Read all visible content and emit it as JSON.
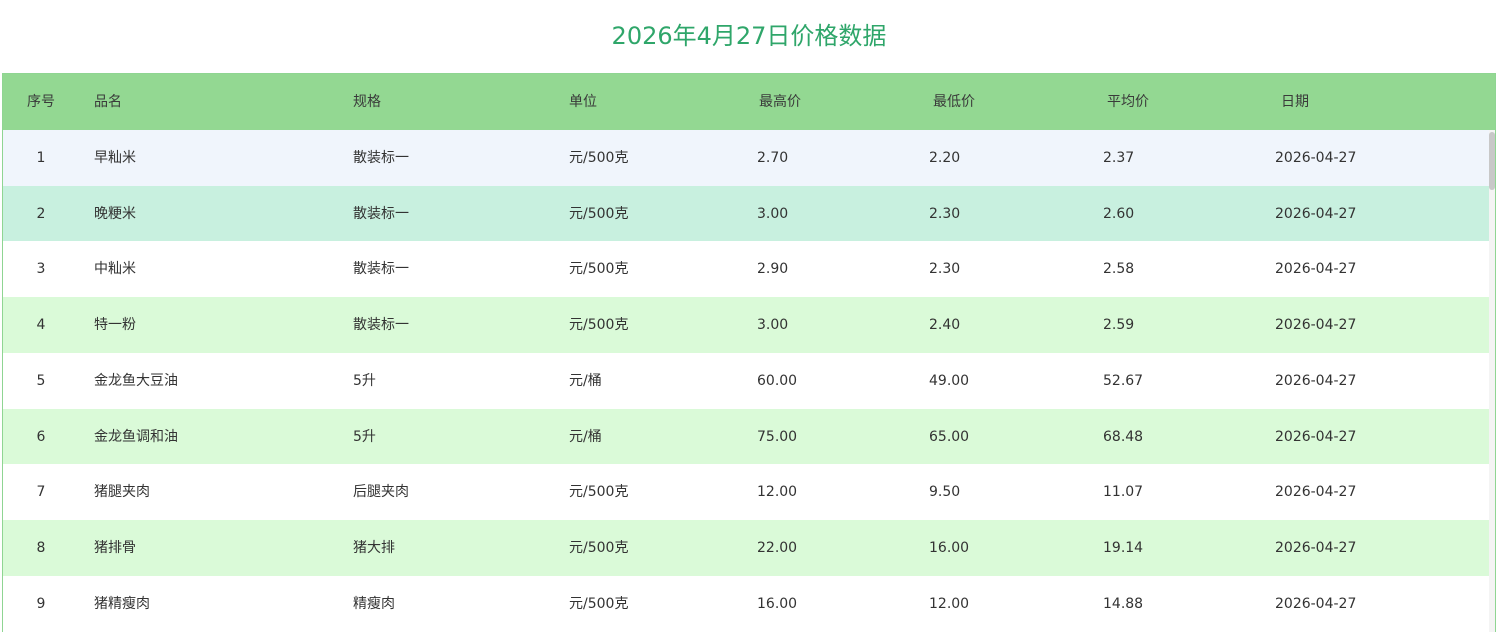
{
  "title": "2026年4月27日价格数据",
  "headers": [
    "序号",
    "品名",
    "规格",
    "单位",
    "最高价",
    "最低价",
    "平均价",
    "日期"
  ],
  "rows": [
    [
      "1",
      "早籼米",
      "散装标一",
      "元/500克",
      "2.70",
      "2.20",
      "2.37",
      "2026-04-27"
    ],
    [
      "2",
      "晚粳米",
      "散装标一",
      "元/500克",
      "3.00",
      "2.30",
      "2.60",
      "2026-04-27"
    ],
    [
      "3",
      "中籼米",
      "散装标一",
      "元/500克",
      "2.90",
      "2.30",
      "2.58",
      "2026-04-27"
    ],
    [
      "4",
      "特一粉",
      "散装标一",
      "元/500克",
      "3.00",
      "2.40",
      "2.59",
      "2026-04-27"
    ],
    [
      "5",
      "金龙鱼大豆油",
      "5升",
      "元/桶",
      "60.00",
      "49.00",
      "52.67",
      "2026-04-27"
    ],
    [
      "6",
      "金龙鱼调和油",
      "5升",
      "元/桶",
      "75.00",
      "65.00",
      "68.48",
      "2026-04-27"
    ],
    [
      "7",
      "猪腿夹肉",
      "后腿夹肉",
      "元/500克",
      "12.00",
      "9.50",
      "11.07",
      "2026-04-27"
    ],
    [
      "8",
      "猪排骨",
      "猪大排",
      "元/500克",
      "22.00",
      "16.00",
      "19.14",
      "2026-04-27"
    ],
    [
      "9",
      "猪精瘦肉",
      "精瘦肉",
      "元/500克",
      "16.00",
      "12.00",
      "14.88",
      "2026-04-27"
    ]
  ],
  "colors": {
    "title": "#2fa66a",
    "header_bg": "#93d892",
    "row_hover": "#f0f5fc",
    "row_selected": "#c8f0df",
    "row_striped": "#dafad8",
    "row_plain": "#ffffff"
  },
  "row_states": [
    "hover",
    "selected",
    "plain",
    "striped",
    "plain",
    "striped",
    "plain",
    "striped",
    "plain"
  ]
}
